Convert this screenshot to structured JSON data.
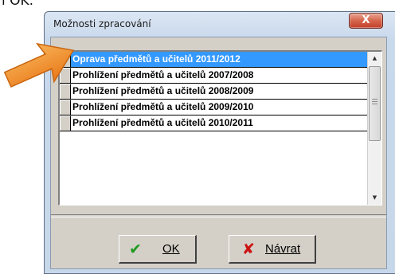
{
  "background_fragment": "í OK.",
  "window": {
    "title": "Možnosti zpracování",
    "close_glyph": "X"
  },
  "list": {
    "items": [
      {
        "label": "Oprava předmětů a učitelů 2011/2012",
        "selected": true
      },
      {
        "label": "Prohlížení předmětů a učitelů 2007/2008",
        "selected": false
      },
      {
        "label": "Prohlížení předmětů a učitelů 2008/2009",
        "selected": false
      },
      {
        "label": "Prohlížení předmětů a učitelů 2009/2010",
        "selected": false
      },
      {
        "label": "Prohlížení předmětů a učitelů 2010/2011",
        "selected": false
      }
    ],
    "scroll_up_glyph": "▲",
    "scroll_down_glyph": "▼"
  },
  "buttons": {
    "ok": {
      "label": "OK",
      "icon": "check-icon",
      "glyph": "✔"
    },
    "back": {
      "label": "Návrat",
      "icon": "cross-icon",
      "glyph": "✘"
    }
  },
  "colors": {
    "selection": "#3399ff",
    "arrow_pointer": "#f08a24"
  }
}
